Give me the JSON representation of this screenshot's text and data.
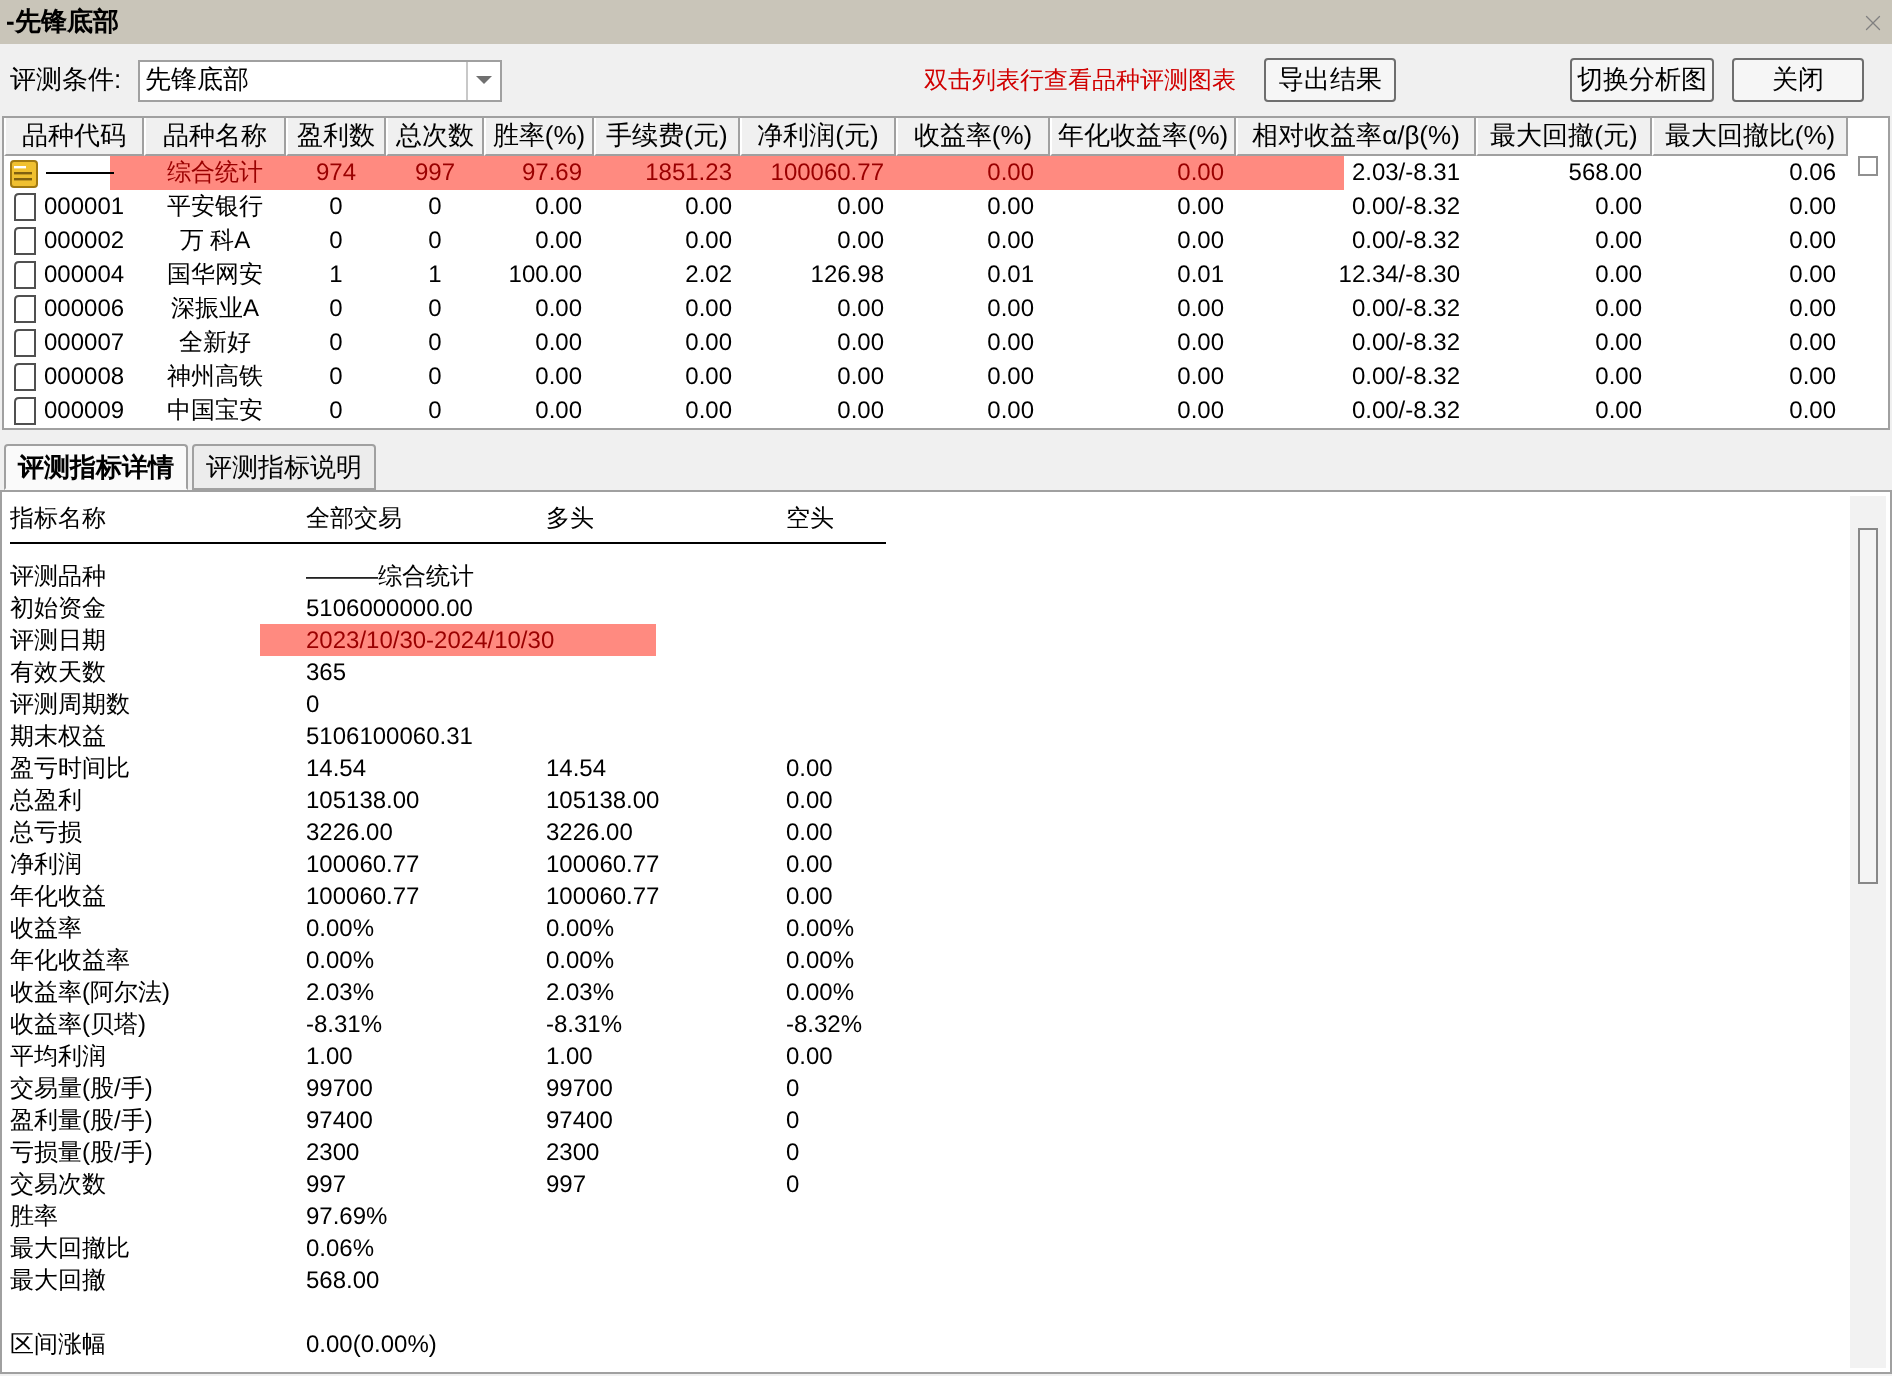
{
  "window": {
    "title": "-先锋底部"
  },
  "toolbar": {
    "filter_label": "评测条件:",
    "filter_value": "先锋底部",
    "hint": "双击列表行查看品种评测图表",
    "buttons": [
      "导出结果",
      "切换分析图",
      "关闭"
    ]
  },
  "table": {
    "columns": [
      "品种代码",
      "品种名称",
      "盈利数",
      "总次数",
      "胜率(%)",
      "手续费(元)",
      "净利润(元)",
      "收益率(%)",
      "年化收益率(%)",
      "相对收益率α/β(%)",
      "最大回撤(元)",
      "最大回撤比(%)"
    ],
    "rows": [
      {
        "kind": "summary",
        "highlighted": true,
        "name": "综合统计",
        "values": [
          "974",
          "997",
          "97.69",
          "1851.23",
          "100060.77",
          "0.00",
          "0.00",
          "2.03/-8.31",
          "568.00",
          "0.06"
        ]
      },
      {
        "kind": "stock",
        "highlighted": false,
        "code": "000001",
        "name": "平安银行",
        "values": [
          "0",
          "0",
          "0.00",
          "0.00",
          "0.00",
          "0.00",
          "0.00",
          "0.00/-8.32",
          "0.00",
          "0.00"
        ]
      },
      {
        "kind": "stock",
        "highlighted": false,
        "code": "000002",
        "name": "万 科A",
        "values": [
          "0",
          "0",
          "0.00",
          "0.00",
          "0.00",
          "0.00",
          "0.00",
          "0.00/-8.32",
          "0.00",
          "0.00"
        ]
      },
      {
        "kind": "stock",
        "highlighted": false,
        "code": "000004",
        "name": "国华网安",
        "values": [
          "1",
          "1",
          "100.00",
          "2.02",
          "126.98",
          "0.01",
          "0.01",
          "12.34/-8.30",
          "0.00",
          "0.00"
        ]
      },
      {
        "kind": "stock",
        "highlighted": false,
        "code": "000006",
        "name": "深振业A",
        "values": [
          "0",
          "0",
          "0.00",
          "0.00",
          "0.00",
          "0.00",
          "0.00",
          "0.00/-8.32",
          "0.00",
          "0.00"
        ]
      },
      {
        "kind": "stock",
        "highlighted": false,
        "code": "000007",
        "name": "全新好",
        "values": [
          "0",
          "0",
          "0.00",
          "0.00",
          "0.00",
          "0.00",
          "0.00",
          "0.00/-8.32",
          "0.00",
          "0.00"
        ]
      },
      {
        "kind": "stock",
        "highlighted": false,
        "code": "000008",
        "name": "神州高铁",
        "values": [
          "0",
          "0",
          "0.00",
          "0.00",
          "0.00",
          "0.00",
          "0.00",
          "0.00/-8.32",
          "0.00",
          "0.00"
        ]
      },
      {
        "kind": "stock",
        "highlighted": false,
        "code": "000009",
        "name": "中国宝安",
        "values": [
          "0",
          "0",
          "0.00",
          "0.00",
          "0.00",
          "0.00",
          "0.00",
          "0.00/-8.32",
          "0.00",
          "0.00"
        ]
      }
    ]
  },
  "tabs": [
    {
      "label": "评测指标详情",
      "selected": true
    },
    {
      "label": "评测指标说明",
      "selected": false
    }
  ],
  "detail": {
    "columns": [
      "指标名称",
      "全部交易",
      "多头",
      "空头"
    ],
    "groups": [
      {
        "rows": [
          {
            "label": "评测品种",
            "highlighted": false,
            "values": [
              "———综合统计"
            ]
          },
          {
            "label": "初始资金",
            "highlighted": false,
            "values": [
              "5106000000.00"
            ]
          },
          {
            "label": "评测日期",
            "highlighted": true,
            "values": [
              "2023/10/30-2024/10/30"
            ]
          },
          {
            "label": "有效天数",
            "highlighted": false,
            "values": [
              "365"
            ]
          },
          {
            "label": "评测周期数",
            "highlighted": false,
            "values": [
              "0"
            ]
          },
          {
            "label": "期末权益",
            "highlighted": false,
            "values": [
              "5106100060.31"
            ]
          },
          {
            "label": "盈亏时间比",
            "highlighted": false,
            "values": [
              "14.54",
              "14.54",
              "0.00"
            ]
          },
          {
            "label": "总盈利",
            "highlighted": false,
            "values": [
              "105138.00",
              "105138.00",
              "0.00"
            ]
          },
          {
            "label": "总亏损",
            "highlighted": false,
            "values": [
              "3226.00",
              "3226.00",
              "0.00"
            ]
          },
          {
            "label": "净利润",
            "highlighted": false,
            "values": [
              "100060.77",
              "100060.77",
              "0.00"
            ]
          },
          {
            "label": "年化收益",
            "highlighted": false,
            "values": [
              "100060.77",
              "100060.77",
              "0.00"
            ]
          },
          {
            "label": "收益率",
            "highlighted": false,
            "values": [
              "0.00%",
              "0.00%",
              "0.00%"
            ]
          },
          {
            "label": "年化收益率",
            "highlighted": false,
            "values": [
              "0.00%",
              "0.00%",
              "0.00%"
            ]
          },
          {
            "label": "收益率(阿尔法)",
            "highlighted": false,
            "values": [
              "2.03%",
              "2.03%",
              "0.00%"
            ]
          },
          {
            "label": "收益率(贝塔)",
            "highlighted": false,
            "values": [
              "-8.31%",
              "-8.31%",
              "-8.32%"
            ]
          },
          {
            "label": "平均利润",
            "highlighted": false,
            "values": [
              "1.00",
              "1.00",
              "0.00"
            ]
          },
          {
            "label": "交易量(股/手)",
            "highlighted": false,
            "values": [
              "99700",
              "99700",
              "0"
            ]
          },
          {
            "label": "盈利量(股/手)",
            "highlighted": false,
            "values": [
              "97400",
              "97400",
              "0"
            ]
          },
          {
            "label": "亏损量(股/手)",
            "highlighted": false,
            "values": [
              "2300",
              "2300",
              "0"
            ]
          },
          {
            "label": "交易次数",
            "highlighted": false,
            "values": [
              "997",
              "997",
              "0"
            ]
          },
          {
            "label": "胜率",
            "highlighted": false,
            "values": [
              "97.69%"
            ]
          },
          {
            "label": "最大回撤比",
            "highlighted": false,
            "values": [
              "0.06%"
            ]
          },
          {
            "label": "最大回撤",
            "highlighted": false,
            "values": [
              "568.00"
            ]
          }
        ]
      },
      {
        "rows": [
          {
            "label": "区间涨幅",
            "highlighted": false,
            "values": [
              "0.00(0.00%)"
            ]
          }
        ]
      }
    ]
  }
}
